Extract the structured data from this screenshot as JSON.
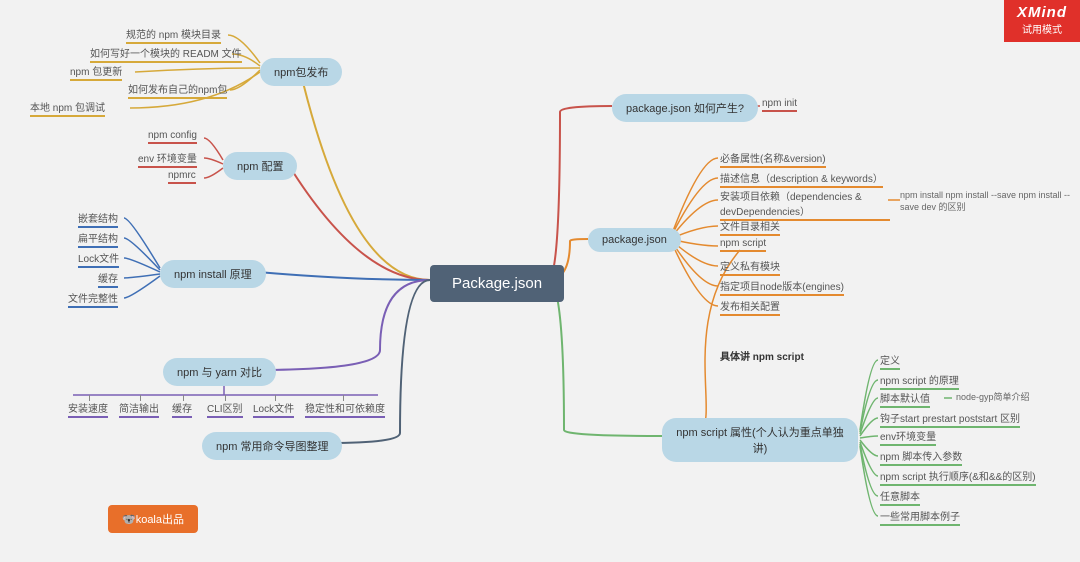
{
  "watermark": {
    "brand": "XMind",
    "sub": "试用模式"
  },
  "badge": "🐨koala出品",
  "root": "Package.json",
  "nodes": {
    "npm_publish": "npm包发布",
    "npm_config": "npm 配置",
    "npm_install": "npm install 原理",
    "npm_yarn": "npm 与 yarn 对比",
    "npm_cmds": "npm 常用命令导图整理",
    "pkg_how": "package.json 如何产生?",
    "pkg_json": "package.json",
    "npm_script": "npm script 属性(个人认为重点单独讲)"
  },
  "annotation": "具体讲 npm script",
  "leaves": {
    "publish": [
      "规范的 npm 模块目录",
      "如何写好一个模块的 READM 文件",
      "npm 包更新",
      "如何发布自己的npm包",
      "本地 npm 包调试"
    ],
    "config": [
      "npm config",
      "env 环境变量",
      "npmrc"
    ],
    "install": [
      "嵌套结构",
      "扁平结构",
      "Lock文件",
      "缓存",
      "文件完整性"
    ],
    "yarn": [
      "安装速度",
      "简洁输出",
      "缓存",
      "CLI区别",
      "Lock文件",
      "稳定性和可依赖度"
    ],
    "how": [
      "npm init"
    ],
    "pkg": [
      "必备属性(名称&version)",
      "描述信息（description & keywords）",
      "安装项目依赖（dependencies & devDependencies）",
      "文件目录相关",
      "npm script",
      "定义私有模块",
      "指定项目node版本(engines)",
      "发布相关配置"
    ],
    "pkg_note": "npm install npm install --save npm install --save dev 的区别",
    "script": [
      "定义",
      "npm script 的原理",
      "脚本默认值",
      "钩子start prestart poststart 区别",
      "env环境变量",
      "npm 脚本传入参数",
      "npm script 执行顺序(&和&&的区别)",
      "任意脚本",
      "一些常用脚本例子"
    ],
    "script_note": "node-gyp简单介绍"
  }
}
